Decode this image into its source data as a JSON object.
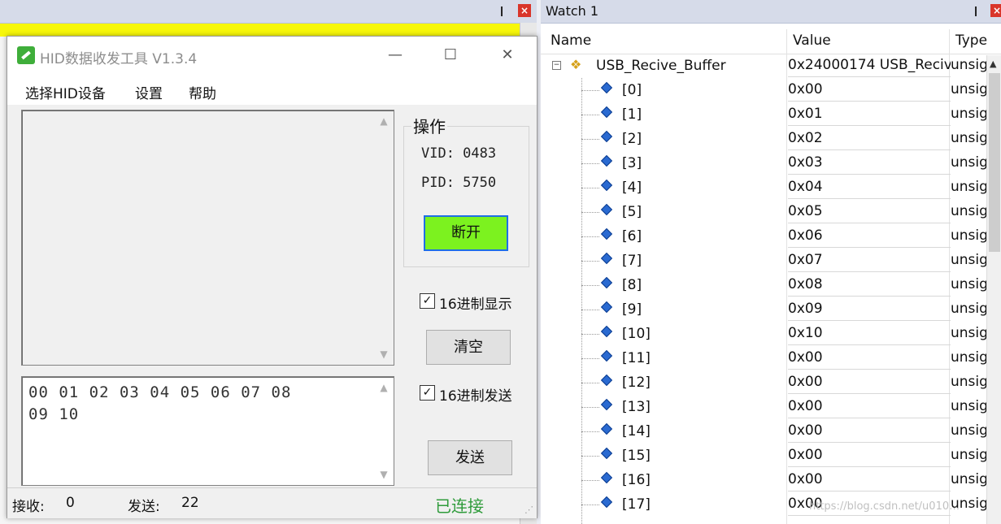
{
  "ide": {
    "pin_glyph": "❙",
    "close_glyph": "×"
  },
  "hid_window": {
    "title": "HID数据收发工具 V1.3.4",
    "controls": {
      "minimize": "—",
      "maximize": "☐",
      "close": "✕"
    },
    "menu": [
      "选择HID设备",
      "设置",
      "帮助"
    ],
    "receive_text": "",
    "send_text": "00 01 02 03 04 05 06 07 08\n09 10",
    "ops_group": {
      "label": "操作",
      "vid": "VID: 0483",
      "pid": "PID: 5750",
      "disconnect_label": "断开"
    },
    "hex_display_label": "16进制显示",
    "hex_display_checked": true,
    "clear_label": "清空",
    "hex_send_label": "16进制发送",
    "hex_send_checked": true,
    "send_label": "发送",
    "status": {
      "recv_label": "接收:",
      "recv_value": "0",
      "sent_label": "发送:",
      "sent_value": "22",
      "connection": "已连接"
    },
    "colors": {
      "disconnect_bg": "#7cf21f",
      "connected_text": "#2e9b3a"
    }
  },
  "watch": {
    "title": "Watch 1",
    "columns": {
      "name": "Name",
      "value": "Value",
      "type": "Type"
    },
    "root": {
      "name": "USB_Recive_Buffer",
      "value": "0x24000174 USB_Reciv...",
      "type": "unsig"
    },
    "rows": [
      {
        "name": "[0]",
        "value": "0x00",
        "type": "unsig"
      },
      {
        "name": "[1]",
        "value": "0x01",
        "type": "unsig"
      },
      {
        "name": "[2]",
        "value": "0x02",
        "type": "unsig"
      },
      {
        "name": "[3]",
        "value": "0x03",
        "type": "unsig"
      },
      {
        "name": "[4]",
        "value": "0x04",
        "type": "unsig"
      },
      {
        "name": "[5]",
        "value": "0x05",
        "type": "unsig"
      },
      {
        "name": "[6]",
        "value": "0x06",
        "type": "unsig"
      },
      {
        "name": "[7]",
        "value": "0x07",
        "type": "unsig"
      },
      {
        "name": "[8]",
        "value": "0x08",
        "type": "unsig"
      },
      {
        "name": "[9]",
        "value": "0x09",
        "type": "unsig"
      },
      {
        "name": "[10]",
        "value": "0x10",
        "type": "unsig"
      },
      {
        "name": "[11]",
        "value": "0x00",
        "type": "unsig"
      },
      {
        "name": "[12]",
        "value": "0x00",
        "type": "unsig"
      },
      {
        "name": "[13]",
        "value": "0x00",
        "type": "unsig"
      },
      {
        "name": "[14]",
        "value": "0x00",
        "type": "unsig"
      },
      {
        "name": "[15]",
        "value": "0x00",
        "type": "unsig"
      },
      {
        "name": "[16]",
        "value": "0x00",
        "type": "unsig"
      },
      {
        "name": "[17]",
        "value": "0x00",
        "type": "unsig"
      }
    ],
    "watermark": "https://blog.csdn.net/u010…"
  }
}
